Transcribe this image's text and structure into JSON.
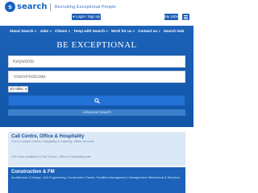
{
  "header": {
    "logo_mark": "s",
    "logo_text": "search",
    "tagline": "Recruiting Exceptional People",
    "login_label": "Login / Sign up",
    "jobs_label": "My Jobs"
  },
  "nav": {
    "items": [
      {
        "label": "About Search »"
      },
      {
        "label": "Jobs »"
      },
      {
        "label": "Clients »"
      },
      {
        "label": "Temp with Search »"
      },
      {
        "label": "Work for us »"
      },
      {
        "label": "Contact us »"
      },
      {
        "label": "Search Hub"
      }
    ]
  },
  "hero": {
    "title": "BE EXCEPTIONAL",
    "keywords_placeholder": "Keywords",
    "town_placeholder": "Town/Postcode",
    "radius_value": "10 miles",
    "advanced_label": "Advanced Search"
  },
  "cards": [
    {
      "title": "Call Centre, Office & Hospitality",
      "subtitle": "Call & Contact Centre, Hospitality & Catering, Office Services",
      "count": "100+ jobs available in Call Centre, Office & Hospitality jobs"
    },
    {
      "title": "Construction & FM",
      "subtitle": "Architecture & Design, Civil Engineering, Construction Trades, Facilities Management, Management, Mechanical & Electrical"
    }
  ],
  "colors": {
    "brand_blue": "#1b62b8",
    "card_light": "#dbe8f6"
  }
}
